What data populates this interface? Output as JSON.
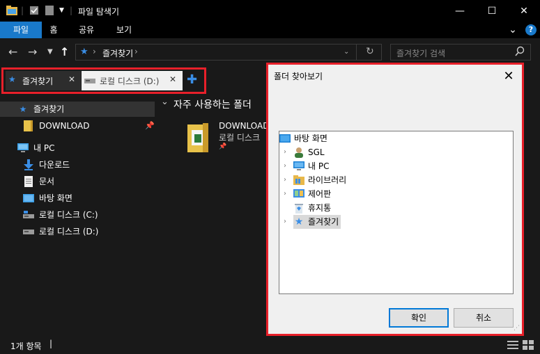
{
  "window": {
    "title": "파일 탐색기",
    "minimize": "—",
    "maximize": "☐",
    "close": "✕"
  },
  "ribbon": {
    "tabs": [
      "파일",
      "홈",
      "공유",
      "보기"
    ],
    "collapse_icon": "⌄",
    "help_icon": "?"
  },
  "address": {
    "path": "즐겨찾기",
    "separator": "›",
    "search_placeholder": "즐겨찾기 검색"
  },
  "tabs": [
    {
      "label": "즐겨찾기",
      "active": true
    },
    {
      "label": "로컬 디스크 (D:)",
      "active": false
    }
  ],
  "nav": {
    "items": [
      {
        "label": "즐겨찾기",
        "icon": "star-icon",
        "selected": true
      },
      {
        "label": "DOWNLOAD",
        "icon": "folder-icon",
        "pinned": true
      },
      {
        "label": "내 PC",
        "icon": "pc-icon"
      },
      {
        "label": "다운로드",
        "icon": "download-icon"
      },
      {
        "label": "문서",
        "icon": "document-icon"
      },
      {
        "label": "바탕 화면",
        "icon": "desktop-icon"
      },
      {
        "label": "로컬 디스크 (C:)",
        "icon": "drive-icon"
      },
      {
        "label": "로컬 디스크 (D:)",
        "icon": "drive-icon"
      }
    ]
  },
  "content": {
    "section_title": "자주 사용하는 폴더",
    "folder_name": "DOWNLOAD",
    "folder_location": "로컬 디스크"
  },
  "status": {
    "count": "1개 항목"
  },
  "dialog": {
    "title": "폴더 찾아보기",
    "tree": [
      {
        "label": "바탕 화면",
        "icon": "desktop-icon",
        "level": 0,
        "expandable": false
      },
      {
        "label": "SGL",
        "icon": "user-icon",
        "level": 1,
        "expandable": true
      },
      {
        "label": "내 PC",
        "icon": "pc-icon",
        "level": 1,
        "expandable": true
      },
      {
        "label": "라이브러리",
        "icon": "library-icon",
        "level": 1,
        "expandable": true
      },
      {
        "label": "제어판",
        "icon": "control-panel-icon",
        "level": 1,
        "expandable": true
      },
      {
        "label": "휴지통",
        "icon": "recycle-bin-icon",
        "level": 1,
        "expandable": false
      },
      {
        "label": "즐겨찾기",
        "icon": "star-icon",
        "level": 1,
        "expandable": true,
        "selected": true
      }
    ],
    "ok": "확인",
    "cancel": "취소"
  },
  "colors": {
    "accent": "#1979ca",
    "highlight": "#e8202a"
  }
}
